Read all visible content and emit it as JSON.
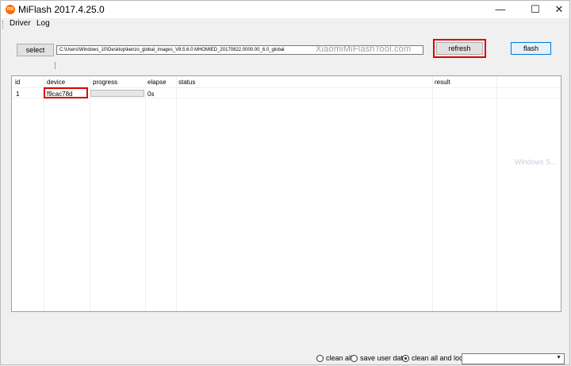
{
  "window": {
    "app_icon": "mi-logo-icon",
    "title": "MiFlash 2017.4.25.0",
    "controls": {
      "minimize": "—",
      "maximize": "☐",
      "close": "✕"
    }
  },
  "menu": {
    "items": [
      "Driver",
      "Log"
    ]
  },
  "toolbar": {
    "select_label": "select",
    "path_value": "C:\\Users\\Windows_10\\Desktop\\kenzo_global_images_V8.5.6.0.MHOMIED_20170822.0000.00_6.0_global",
    "watermark": "XiaomiMiFlashTool.com",
    "refresh_label": "refresh",
    "flash_label": "flash"
  },
  "grid": {
    "columns": [
      "id",
      "device",
      "progress",
      "elapse",
      "status",
      "result"
    ],
    "rows": [
      {
        "id": "1",
        "device": "f9cac78d",
        "progress": 0,
        "elapse": "0s",
        "status": "",
        "result": ""
      }
    ]
  },
  "overlay": {
    "windows_toast": "Windows S..."
  },
  "bottom": {
    "options": [
      {
        "label": "clean all",
        "selected": false
      },
      {
        "label": "save user data",
        "selected": false
      },
      {
        "label": "clean all and lock",
        "selected": true
      }
    ],
    "dropdown_value": ""
  },
  "colors": {
    "highlight": "#dd0000",
    "accent": "#0078d7",
    "mi_orange": "#ff6900"
  }
}
